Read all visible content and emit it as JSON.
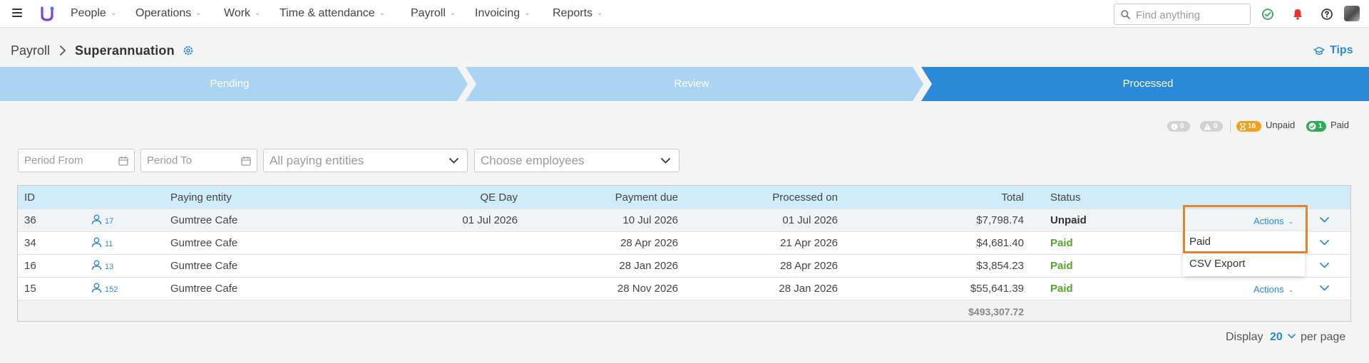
{
  "nav": {
    "items": [
      {
        "label": "People"
      },
      {
        "label": "Operations"
      },
      {
        "label": "Work"
      },
      {
        "label": "Time & attendance"
      },
      {
        "label": "Payroll"
      },
      {
        "label": "Invoicing"
      },
      {
        "label": "Reports"
      }
    ],
    "search_placeholder": "Find anything",
    "icons": [
      "menu-icon",
      "logo",
      "check-circle-icon",
      "bell-icon",
      "help-icon",
      "avatar"
    ],
    "colors": {
      "check": "#2bab54",
      "bell": "#e8322b",
      "brand": "#7b3fe4"
    }
  },
  "header": {
    "breadcrumb": "Payroll",
    "title": "Superannuation",
    "tips": "Tips"
  },
  "stepper": {
    "steps": [
      {
        "label": "Pending",
        "active": false
      },
      {
        "label": "Review",
        "active": false
      },
      {
        "label": "Processed",
        "active": true
      }
    ],
    "colors": {
      "inactive": "#abd3f2",
      "active": "#2a8ad8"
    }
  },
  "counters": {
    "info": "0",
    "warning": "0",
    "unpaid_count": "18",
    "unpaid_label": "Unpaid",
    "paid_count": "1",
    "paid_label": "Paid",
    "colors": {
      "unpaid": "#f0a11e",
      "paid": "#2bab54"
    }
  },
  "filters": {
    "period_from": "Period From",
    "period_to": "Period To",
    "entities": "All paying entities",
    "employees": "Choose employees"
  },
  "table": {
    "headers": {
      "id": "ID",
      "entity": "Paying entity",
      "qe_day": "QE Day",
      "payment_due": "Payment due",
      "processed_on": "Processed on",
      "total": "Total",
      "status": "Status"
    },
    "rows": [
      {
        "id": "36",
        "employees": "17",
        "entity": "Gumtree Cafe",
        "qe_day": "01 Jul 2026",
        "payment_due": "10 Jul 2026",
        "processed_on": "01 Jul 2026",
        "total": "$7,798.74",
        "status": "Unpaid",
        "actions": "Actions"
      },
      {
        "id": "34",
        "employees": "11",
        "entity": "Gumtree Cafe",
        "qe_day": "",
        "payment_due": "28 Apr 2026",
        "processed_on": "21 Apr 2026",
        "total": "$4,681.40",
        "status": "Paid",
        "actions": ""
      },
      {
        "id": "16",
        "employees": "13",
        "entity": "Gumtree Cafe",
        "qe_day": "",
        "payment_due": "28 Jan 2026",
        "processed_on": "28 Apr 2026",
        "total": "$3,854.23",
        "status": "Paid",
        "actions": ""
      },
      {
        "id": "15",
        "employees": "152",
        "entity": "Gumtree Cafe",
        "qe_day": "",
        "payment_due": "28 Nov 2026",
        "processed_on": "28 Jan 2026",
        "total": "$55,641.39",
        "status": "Paid",
        "actions": "Actions"
      }
    ],
    "grand_total": "$493,307.72"
  },
  "actions_menu": {
    "items": [
      "Paid",
      "CSV Export"
    ],
    "highlight_color": "#e8812b"
  },
  "footer": {
    "display": "Display",
    "per_page_value": "20",
    "per_page": "per page"
  }
}
